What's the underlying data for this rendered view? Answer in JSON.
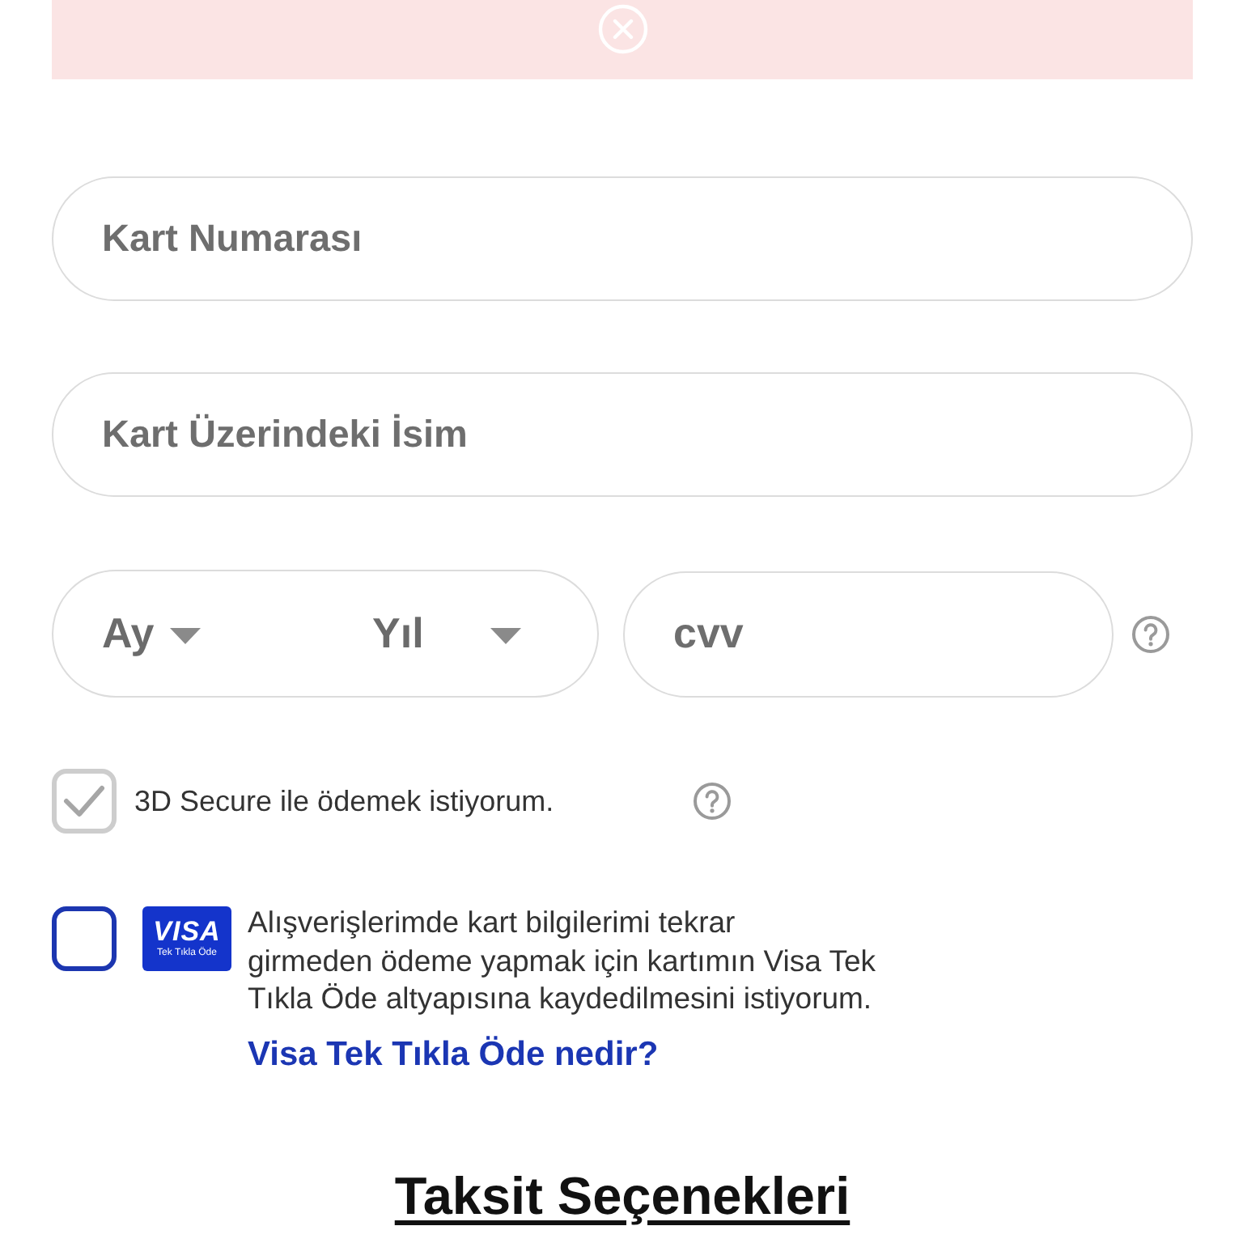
{
  "alert": {
    "kind": "error"
  },
  "card_fields": [
    {
      "placeholder": "Kart Numarası"
    },
    {
      "placeholder": "Kart Üzerindeki İsim"
    }
  ],
  "expiry": {
    "selects": [
      {
        "label": "Ay"
      },
      {
        "label": "Yıl"
      }
    ]
  },
  "cvv": {
    "placeholder": "cvv"
  },
  "options": [
    {
      "kind": "secure",
      "label": "3D Secure ile ödemek istiyorum.",
      "checked": true,
      "disabled": true
    },
    {
      "kind": "visa",
      "label_lines": [
        "Alışverişlerimde kart bilgilerimi tekrar",
        "girmeden ödeme yapmak için kartımın Visa Tek",
        "Tıkla Öde altyapısına kaydedilmesini istiyorum."
      ],
      "checked": false,
      "disabled": false,
      "logo": {
        "brand": "VISA",
        "tagline": "Tek Tıkla Öde"
      },
      "link": "Visa Tek Tıkla Öde nedir?"
    }
  ],
  "installments": {
    "title": "Taksit Seçenekleri"
  }
}
